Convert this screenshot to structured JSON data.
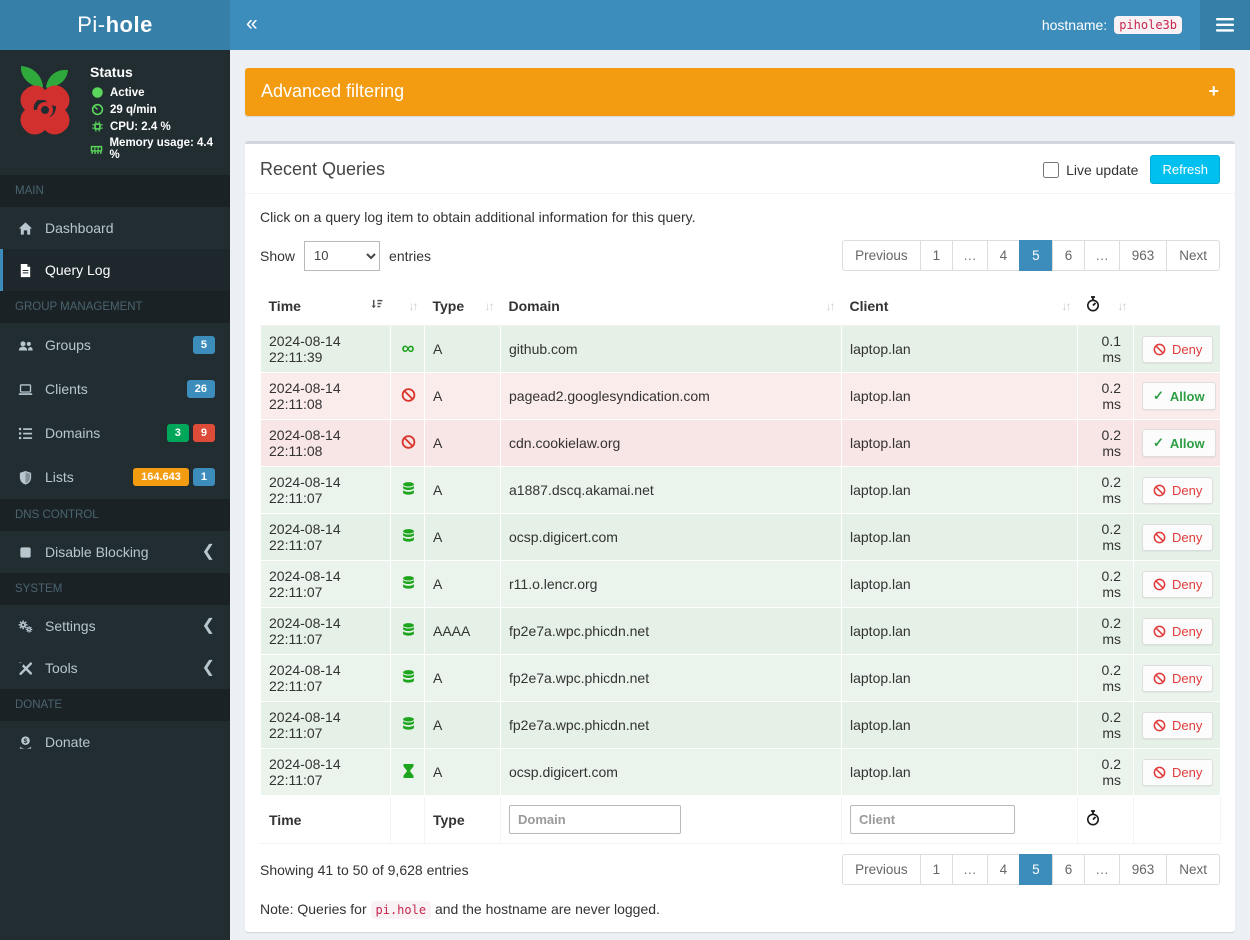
{
  "app": {
    "brand_light": "Pi-",
    "brand_bold": "hole",
    "hostname_label": "hostname:",
    "hostname": "pihole3b"
  },
  "colors": {
    "accent": "#3c8dbc",
    "logo_bg": "#367fa9",
    "sidebar_bg": "#222d32",
    "warning": "#f39c12",
    "info": "#00c0ef",
    "badge_blue": "#3c8dbc",
    "badge_green": "#00a65a",
    "badge_red": "#dd4b39",
    "badge_orange": "#f39c12",
    "allowed_row": "#e8f2e9",
    "blocked_row": "#f9e7e7"
  },
  "sidebar": {
    "status": {
      "title": "Status",
      "items": [
        {
          "icon": "circle-icon",
          "label": "Active"
        },
        {
          "icon": "tachometer-icon",
          "label": "29 q/min"
        },
        {
          "icon": "microchip-icon",
          "label": "CPU: 2.4 %"
        },
        {
          "icon": "memory-icon",
          "label": "Memory usage: 4.4 %"
        }
      ]
    },
    "sections": [
      {
        "header": "MAIN",
        "items": [
          {
            "name": "dashboard",
            "icon": "home-icon",
            "label": "Dashboard"
          },
          {
            "name": "query-log",
            "icon": "file-icon",
            "label": "Query Log",
            "active": true
          }
        ]
      },
      {
        "header": "GROUP MANAGEMENT",
        "items": [
          {
            "name": "groups",
            "icon": "users-icon",
            "label": "Groups",
            "badges": [
              {
                "text": "5",
                "color": "#3c8dbc"
              }
            ]
          },
          {
            "name": "clients",
            "icon": "laptop-icon",
            "label": "Clients",
            "badges": [
              {
                "text": "26",
                "color": "#3c8dbc"
              }
            ]
          },
          {
            "name": "domains",
            "icon": "list-icon",
            "label": "Domains",
            "badges": [
              {
                "text": "3",
                "color": "#00a65a"
              },
              {
                "text": "9",
                "color": "#dd4b39"
              }
            ]
          },
          {
            "name": "lists",
            "icon": "shield-icon",
            "label": "Lists",
            "badges": [
              {
                "text": "164.643",
                "color": "#f39c12"
              },
              {
                "text": "1",
                "color": "#3c8dbc"
              }
            ]
          }
        ]
      },
      {
        "header": "DNS CONTROL",
        "items": [
          {
            "name": "disable-blocking",
            "icon": "stop-icon",
            "label": "Disable Blocking",
            "chevron": true
          }
        ]
      },
      {
        "header": "SYSTEM",
        "items": [
          {
            "name": "settings",
            "icon": "gears-icon",
            "label": "Settings",
            "chevron": true
          },
          {
            "name": "tools",
            "icon": "wrench-icon",
            "label": "Tools",
            "chevron": true
          }
        ]
      },
      {
        "header": "DONATE",
        "items": [
          {
            "name": "donate",
            "icon": "donate-icon",
            "label": "Donate"
          }
        ]
      }
    ]
  },
  "filter_box": {
    "title": "Advanced filtering",
    "expand_label": "+"
  },
  "panel": {
    "title": "Recent Queries",
    "live_update_label": "Live update",
    "refresh_label": "Refresh",
    "hint": "Click on a query log item to obtain additional information for this query.",
    "show_label": "Show",
    "entries_label": "entries",
    "page_size": "10",
    "summary": "Showing 41 to 50 of 9,628 entries",
    "note_prefix": "Note: Queries for",
    "note_code": "pi.hole",
    "note_suffix": "and the hostname are never logged."
  },
  "pagination": {
    "items": [
      {
        "label": "Previous"
      },
      {
        "label": "1"
      },
      {
        "label": "…",
        "ellipsis": true
      },
      {
        "label": "4"
      },
      {
        "label": "5",
        "active": true
      },
      {
        "label": "6"
      },
      {
        "label": "…",
        "ellipsis": true
      },
      {
        "label": "963"
      },
      {
        "label": "Next"
      }
    ]
  },
  "table": {
    "columns": {
      "time": "Time",
      "type": "Type",
      "domain": "Domain",
      "client": "Client"
    },
    "filters": {
      "domain_placeholder": "Domain",
      "client_placeholder": "Client"
    },
    "actions": {
      "deny": "Deny",
      "allow": "Allow"
    },
    "rows": [
      {
        "time": "2024-08-14 22:11:39",
        "status_icon": "infinity-icon",
        "type": "A",
        "domain": "github.com",
        "client": "laptop.lan",
        "reply": "0.1 ms",
        "action": "deny",
        "blocked": false
      },
      {
        "time": "2024-08-14 22:11:08",
        "status_icon": "ban-icon",
        "type": "A",
        "domain": "pagead2.googlesyndication.com",
        "client": "laptop.lan",
        "reply": "0.2 ms",
        "action": "allow",
        "blocked": true
      },
      {
        "time": "2024-08-14 22:11:08",
        "status_icon": "ban-icon",
        "type": "A",
        "domain": "cdn.cookielaw.org",
        "client": "laptop.lan",
        "reply": "0.2 ms",
        "action": "allow",
        "blocked": true
      },
      {
        "time": "2024-08-14 22:11:07",
        "status_icon": "database-icon",
        "type": "A",
        "domain": "a1887.dscq.akamai.net",
        "client": "laptop.lan",
        "reply": "0.2 ms",
        "action": "deny",
        "blocked": false
      },
      {
        "time": "2024-08-14 22:11:07",
        "status_icon": "database-icon",
        "type": "A",
        "domain": "ocsp.digicert.com",
        "client": "laptop.lan",
        "reply": "0.2 ms",
        "action": "deny",
        "blocked": false
      },
      {
        "time": "2024-08-14 22:11:07",
        "status_icon": "database-icon",
        "type": "A",
        "domain": "r11.o.lencr.org",
        "client": "laptop.lan",
        "reply": "0.2 ms",
        "action": "deny",
        "blocked": false
      },
      {
        "time": "2024-08-14 22:11:07",
        "status_icon": "database-icon",
        "type": "AAAA",
        "domain": "fp2e7a.wpc.phicdn.net",
        "client": "laptop.lan",
        "reply": "0.2 ms",
        "action": "deny",
        "blocked": false
      },
      {
        "time": "2024-08-14 22:11:07",
        "status_icon": "database-icon",
        "type": "A",
        "domain": "fp2e7a.wpc.phicdn.net",
        "client": "laptop.lan",
        "reply": "0.2 ms",
        "action": "deny",
        "blocked": false
      },
      {
        "time": "2024-08-14 22:11:07",
        "status_icon": "database-icon",
        "type": "A",
        "domain": "fp2e7a.wpc.phicdn.net",
        "client": "laptop.lan",
        "reply": "0.2 ms",
        "action": "deny",
        "blocked": false
      },
      {
        "time": "2024-08-14 22:11:07",
        "status_icon": "hourglass-icon",
        "type": "A",
        "domain": "ocsp.digicert.com",
        "client": "laptop.lan",
        "reply": "0.2 ms",
        "action": "deny",
        "blocked": false
      }
    ]
  }
}
